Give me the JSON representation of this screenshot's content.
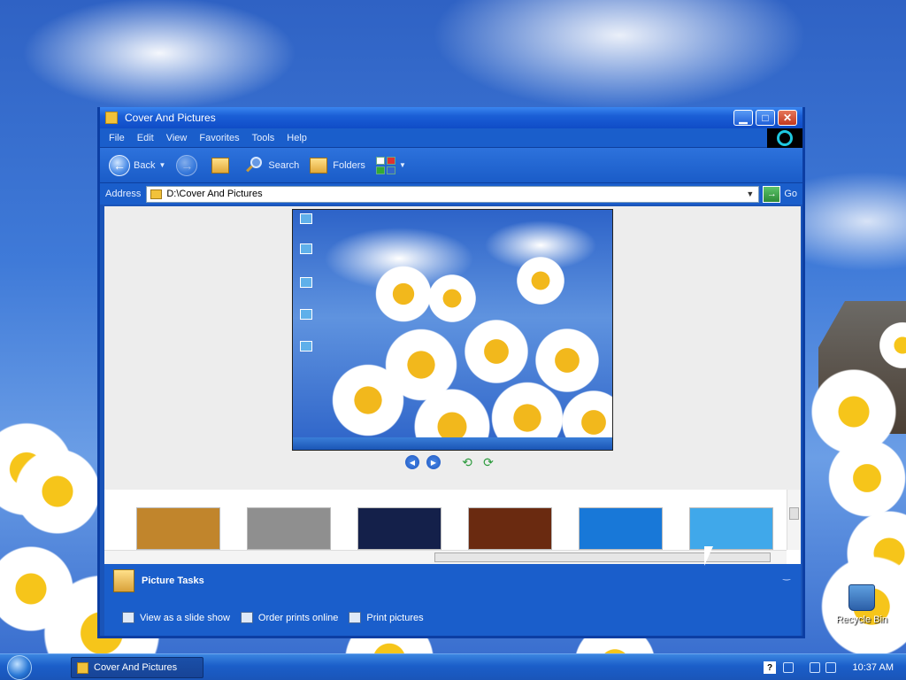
{
  "window": {
    "title": "Cover And Pictures",
    "controls": {
      "minimize": "▁",
      "maximize": "□",
      "close": "✕"
    }
  },
  "menu": [
    "File",
    "Edit",
    "View",
    "Favorites",
    "Tools",
    "Help"
  ],
  "toolbar": {
    "back": "Back",
    "search": "Search",
    "folders": "Folders"
  },
  "address": {
    "label": "Address",
    "value": "D:\\Cover And Pictures",
    "go": "Go"
  },
  "preview": {
    "icons": [
      "search-icon",
      "computer-icon",
      "network-places-icon",
      "recycle-bin-icon",
      "internet-explorer-icon"
    ]
  },
  "filmstrip": {
    "thumbnails": [
      {
        "name": "city-night-thumb",
        "color": "#c1852c"
      },
      {
        "name": "gray-clouds-thumb",
        "color": "#8f8f8f"
      },
      {
        "name": "dark-desktop-thumb",
        "color": "#14204a"
      },
      {
        "name": "orange-spiral-thumb",
        "color": "#6a2a10"
      },
      {
        "name": "windows-logo-thumb",
        "color": "#1878d8"
      },
      {
        "name": "windows-disc-thumb",
        "color": "#40a8ea"
      }
    ]
  },
  "tasks": {
    "header": "Picture Tasks",
    "links": [
      "View as a slide show",
      "Order prints online",
      "Print pictures"
    ]
  },
  "desktop": {
    "recycle_bin": "Recycle Bin"
  },
  "taskbar": {
    "window_button": "Cover And Pictures",
    "help": "?",
    "clock": "10:37 AM"
  }
}
